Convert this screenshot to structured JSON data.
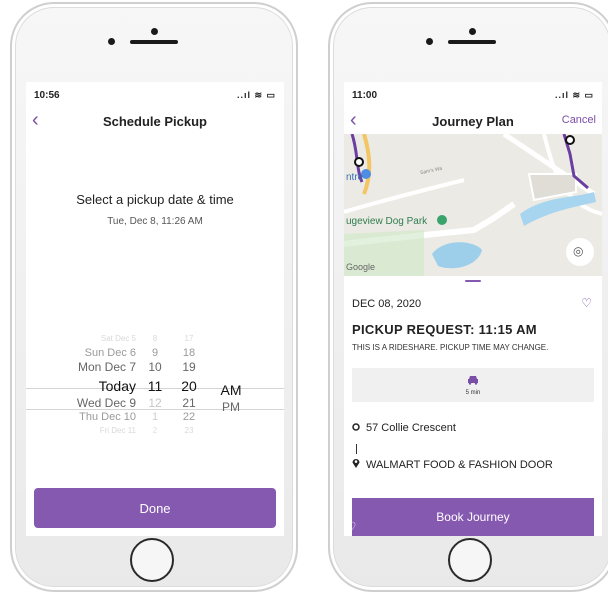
{
  "left": {
    "status": {
      "time": "10:56",
      "indicators": "..ıl ≋ ▭"
    },
    "nav": {
      "back": "‹",
      "title": "Schedule Pickup"
    },
    "prompt": "Select a pickup date & time",
    "prompt_sub": "Tue, Dec 8, 11:26 AM",
    "picker": {
      "dates": [
        "Sat Dec 5",
        "Sun Dec 6",
        "Mon Dec 7",
        "Today",
        "Wed Dec 9",
        "Thu Dec 10",
        "Fri Dec 11"
      ],
      "hours": [
        "8",
        "9",
        "10",
        "11",
        "12",
        "1",
        "2"
      ],
      "minutes": [
        "17",
        "18",
        "19",
        "20",
        "21",
        "22",
        "23"
      ],
      "ampm": [
        "AM",
        "PM"
      ]
    },
    "done": "Done"
  },
  "right": {
    "status": {
      "time": "11:00",
      "indicators": "..ıl ≋ ▭"
    },
    "nav": {
      "back": "‹",
      "title": "Journey Plan",
      "cancel": "Cancel"
    },
    "map": {
      "labels": [
        "ntre",
        "Sam's Wa",
        "ugeview Dog Park",
        "Google"
      ],
      "location_icon": "◎"
    },
    "date": "DEC 08, 2020",
    "request": "PICKUP REQUEST: 11:15 AM",
    "note": "THIS IS A RIDESHARE. PICKUP TIME MAY CHANGE.",
    "ride": {
      "icon": "car-icon",
      "minutes": "5 min"
    },
    "origin": "57 Collie Crescent",
    "destination": "WALMART FOOD & FASHION DOOR",
    "book": "Book Journey"
  },
  "colors": {
    "accent": "#8659b1",
    "link": "#7b4fa6"
  }
}
